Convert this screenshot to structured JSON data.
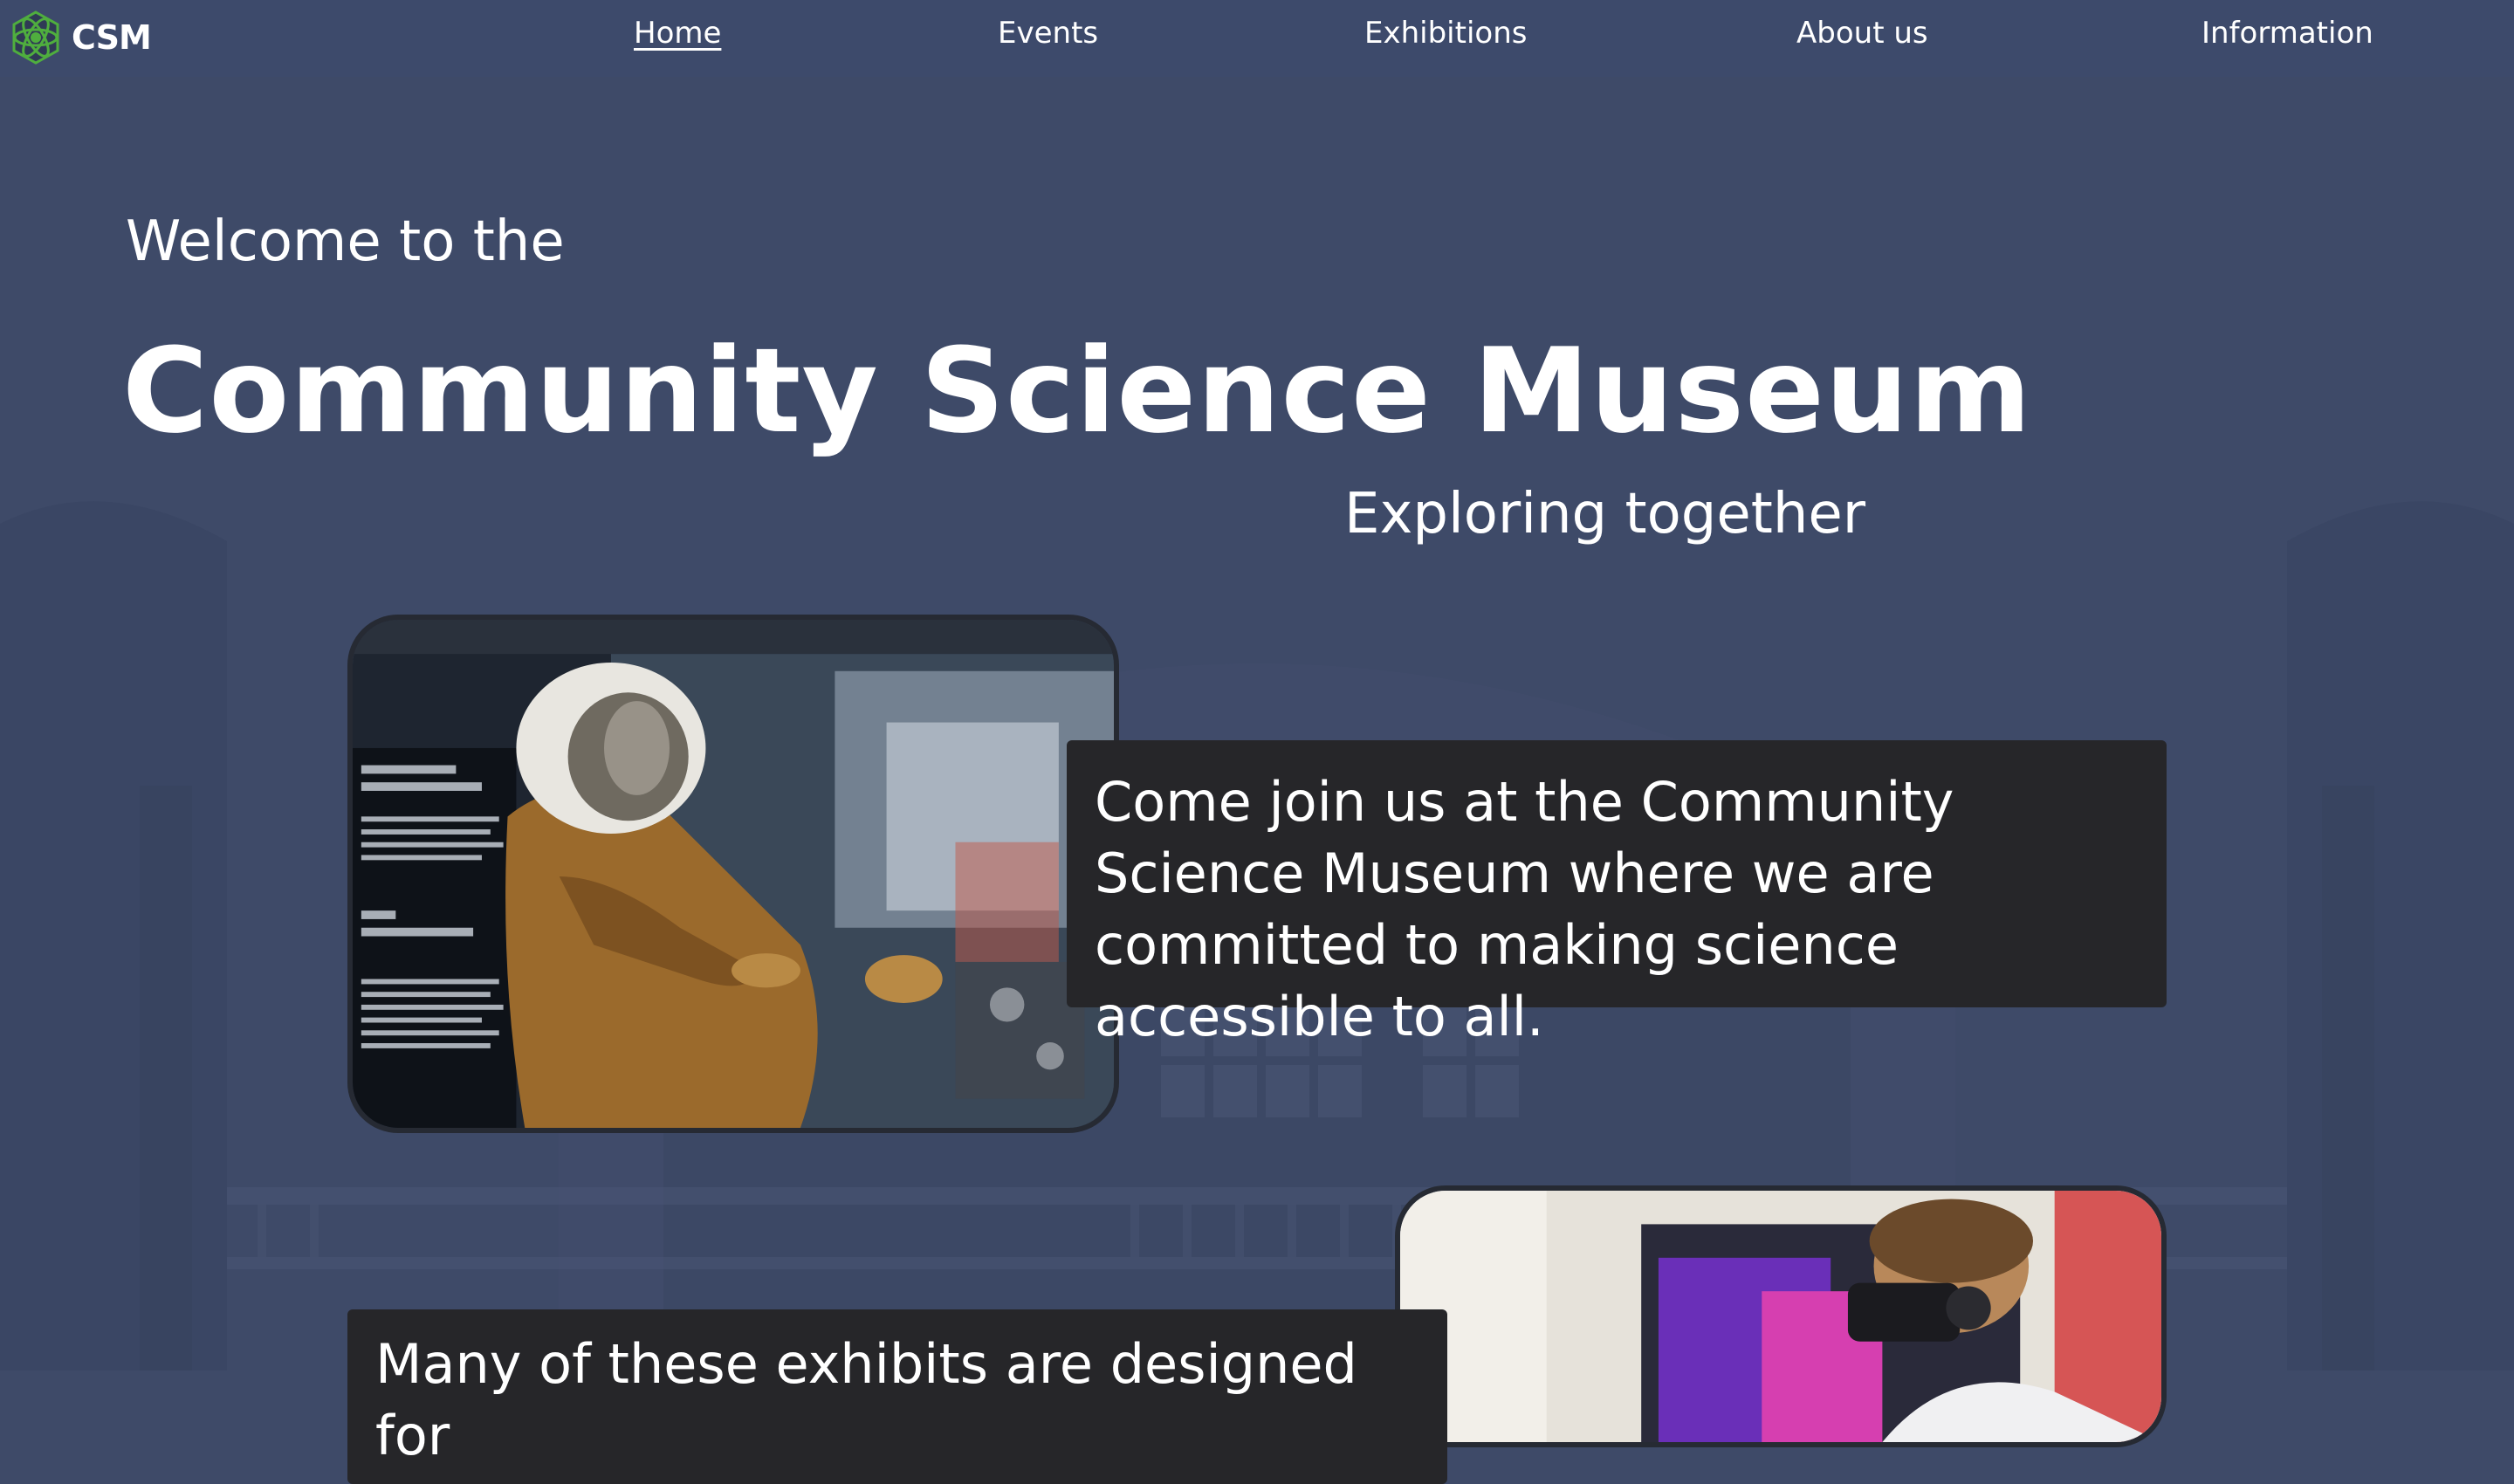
{
  "nav": {
    "logo_text": "CSM",
    "items": [
      {
        "label": "Home",
        "active": true
      },
      {
        "label": "Events",
        "active": false
      },
      {
        "label": "Exhibitions",
        "active": false
      },
      {
        "label": "About us",
        "active": false
      },
      {
        "label": "Information",
        "active": false
      }
    ]
  },
  "hero": {
    "welcome": "Welcome to the",
    "title": "Community Science Museum",
    "tagline": "Exploring together"
  },
  "sections": [
    {
      "image": "astronaut-exhibit-photo",
      "text": "Come join us at the Community Science Museum where we are committed to making science accessible to all."
    },
    {
      "image": "vr-headset-visitor-photo",
      "text": "Many of these exhibits are designed for"
    }
  ],
  "colors": {
    "background": "#3e4a68",
    "navbar": "#3d4a6b",
    "caption_bg": "#262629",
    "logo_green": "#4fae3e"
  }
}
